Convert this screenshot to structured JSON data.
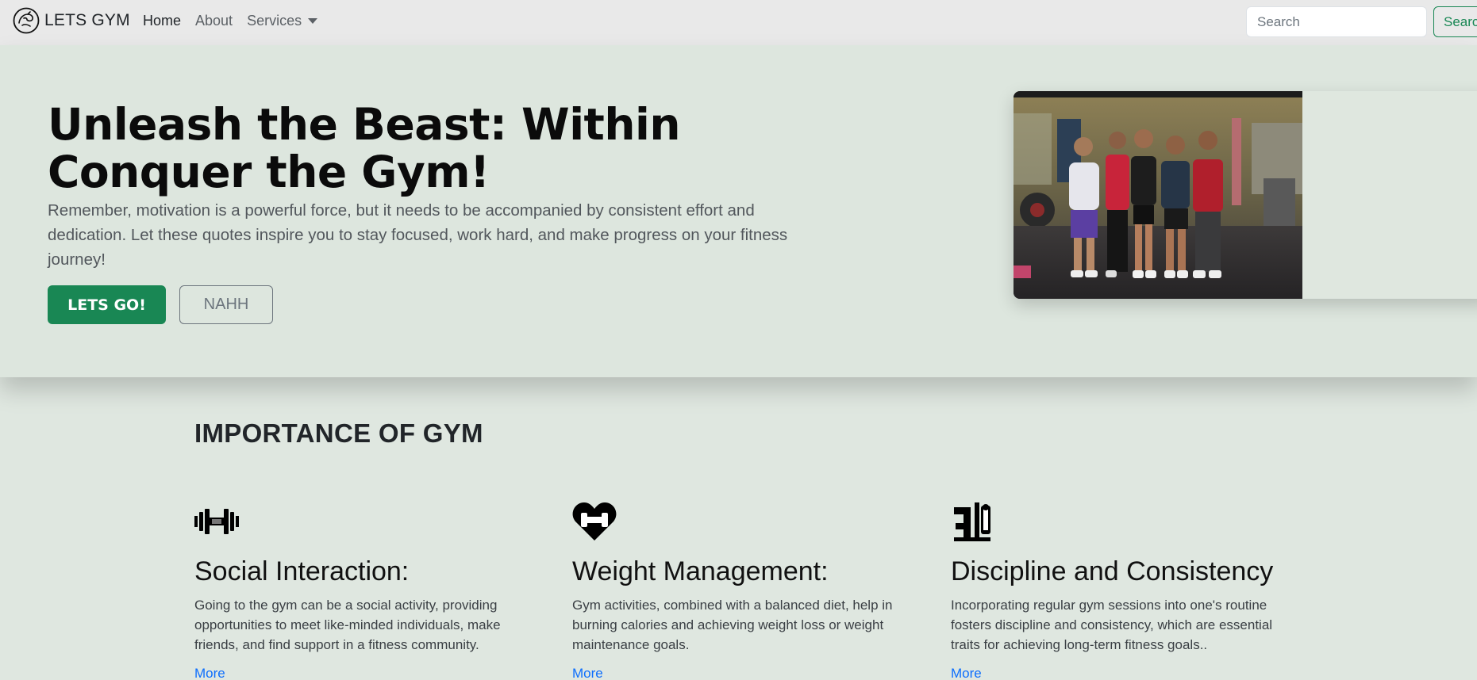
{
  "navbar": {
    "brand": "LETS GYM",
    "links": [
      {
        "label": "Home"
      },
      {
        "label": "About"
      },
      {
        "label": "Services"
      }
    ],
    "search_placeholder": "Search",
    "search_button": "Search"
  },
  "hero": {
    "title_line1": "Unleash the Beast: Within",
    "title_line2": "Conquer the Gym!",
    "text": "Remember, motivation is a powerful force, but it needs to be accompanied by consistent effort and dedication. Let these quotes inspire you to stay focused, work hard, and make progress on your fitness journey!",
    "primary_button": "LETS GO!",
    "secondary_button": "NAHH"
  },
  "features": {
    "title": "IMPORTANCE OF GYM",
    "items": [
      {
        "icon": "dumbbell-icon",
        "title": "Social Interaction:",
        "text": "Going to the gym can be a social activity, providing opportunities to meet like-minded individuals, make friends, and find support in a fitness community.",
        "link": "More"
      },
      {
        "icon": "heart-dumbbell-icon",
        "title": "Weight Management:",
        "text": "Gym activities, combined with a balanced diet, help in burning calories and achieving weight loss or weight maintenance goals.",
        "link": "More"
      },
      {
        "icon": "gym-machine-icon",
        "title": "Discipline and Consistency",
        "text": "Incorporating regular gym sessions into one's routine fosters discipline and consistency, which are essential traits for achieving long-term fitness goals..",
        "link": "More"
      }
    ]
  },
  "colors": {
    "accent": "#198754",
    "link": "#0d6efd",
    "background": "#dfe7e0",
    "navbar": "#e9e9e9"
  }
}
